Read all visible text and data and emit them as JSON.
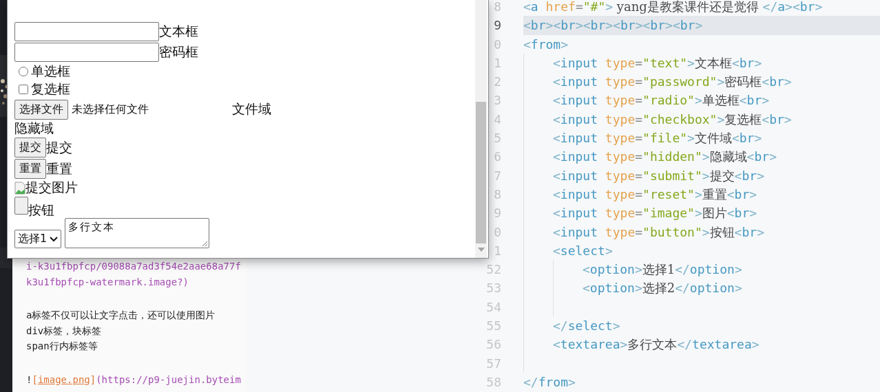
{
  "markdown_pane": {
    "blocks": [
      [
        {
          "tokens": [
            {
              "kind": "url",
              "text": "i-k3u1fbpfcp/09088a7ad3f54e2aae68a77f"
            }
          ]
        },
        {
          "tokens": [
            {
              "kind": "url",
              "text": "k3u1fbpfcp-watermark.image?)"
            }
          ]
        }
      ],
      [
        {
          "tokens": [
            {
              "kind": "text",
              "text": "a标签不仅可以让文字点击，还可以使用图片"
            }
          ]
        },
        {
          "tokens": [
            {
              "kind": "text",
              "text": "div标签，块标签"
            }
          ]
        },
        {
          "tokens": [
            {
              "kind": "text",
              "text": "span行内标签等"
            }
          ]
        }
      ],
      [
        {
          "tokens": [
            {
              "kind": "text",
              "text": "!"
            },
            {
              "kind": "linkmark",
              "text": "["
            },
            {
              "kind": "link",
              "text": "image.png"
            },
            {
              "kind": "linkmark",
              "text": "]"
            },
            {
              "kind": "url",
              "text": "(https://p9-juejin.byteim"
            }
          ]
        }
      ]
    ]
  },
  "editor": {
    "lines": [
      {
        "num": "8",
        "highlighted": false,
        "tokens": [
          {
            "kind": "punct",
            "text": "<"
          },
          {
            "kind": "tag",
            "text": "a"
          },
          {
            "kind": "attr",
            "text": " href"
          },
          {
            "kind": "eq",
            "text": "="
          },
          {
            "kind": "str",
            "text": "\"#\""
          },
          {
            "kind": "punct",
            "text": ">"
          },
          {
            "kind": "text",
            "text": " yang是教案课件还是觉得 "
          },
          {
            "kind": "punct",
            "text": "</"
          },
          {
            "kind": "tag",
            "text": "a"
          },
          {
            "kind": "punct",
            "text": ">"
          },
          {
            "kind": "punct",
            "text": "<"
          },
          {
            "kind": "tag",
            "text": "br"
          },
          {
            "kind": "punct",
            "text": ">"
          }
        ]
      },
      {
        "num": "9",
        "highlighted": true,
        "tokens": [
          {
            "kind": "punct",
            "text": "<"
          },
          {
            "kind": "tag",
            "text": "br"
          },
          {
            "kind": "punct",
            "text": ">"
          },
          {
            "kind": "punct",
            "text": "<"
          },
          {
            "kind": "tag",
            "text": "br"
          },
          {
            "kind": "punct",
            "text": ">"
          },
          {
            "kind": "punct",
            "text": "<"
          },
          {
            "kind": "tag",
            "text": "br"
          },
          {
            "kind": "punct",
            "text": ">"
          },
          {
            "kind": "punct",
            "text": "<"
          },
          {
            "kind": "tag",
            "text": "br"
          },
          {
            "kind": "punct",
            "text": ">"
          },
          {
            "kind": "punct",
            "text": "<"
          },
          {
            "kind": "tag",
            "text": "br"
          },
          {
            "kind": "punct",
            "text": ">"
          },
          {
            "kind": "punct",
            "text": "<"
          },
          {
            "kind": "tag",
            "text": "br"
          },
          {
            "kind": "punct",
            "text": ">"
          }
        ]
      },
      {
        "num": "0",
        "highlighted": false,
        "tokens": [
          {
            "kind": "punct",
            "text": "<"
          },
          {
            "kind": "tag",
            "text": "from"
          },
          {
            "kind": "punct",
            "text": ">"
          }
        ],
        "children": [
          {
            "num": "1",
            "highlighted": false,
            "tokens": [
              {
                "kind": "punct",
                "text": "<"
              },
              {
                "kind": "tag",
                "text": "input"
              },
              {
                "kind": "attr",
                "text": " type"
              },
              {
                "kind": "eq",
                "text": "="
              },
              {
                "kind": "str",
                "text": "\"text\""
              },
              {
                "kind": "punct",
                "text": ">"
              },
              {
                "kind": "text",
                "text": "文本框"
              },
              {
                "kind": "punct",
                "text": "<"
              },
              {
                "kind": "tag",
                "text": "br"
              },
              {
                "kind": "punct",
                "text": ">"
              }
            ]
          },
          {
            "num": "2",
            "highlighted": false,
            "tokens": [
              {
                "kind": "punct",
                "text": "<"
              },
              {
                "kind": "tag",
                "text": "input"
              },
              {
                "kind": "attr",
                "text": " type"
              },
              {
                "kind": "eq",
                "text": "="
              },
              {
                "kind": "str",
                "text": "\"password\""
              },
              {
                "kind": "punct",
                "text": ">"
              },
              {
                "kind": "text",
                "text": "密码框"
              },
              {
                "kind": "punct",
                "text": "<"
              },
              {
                "kind": "tag",
                "text": "br"
              },
              {
                "kind": "punct",
                "text": ">"
              }
            ]
          },
          {
            "num": "3",
            "highlighted": false,
            "tokens": [
              {
                "kind": "punct",
                "text": "<"
              },
              {
                "kind": "tag",
                "text": "input"
              },
              {
                "kind": "attr",
                "text": " type"
              },
              {
                "kind": "eq",
                "text": "="
              },
              {
                "kind": "str",
                "text": "\"radio\""
              },
              {
                "kind": "punct",
                "text": ">"
              },
              {
                "kind": "text",
                "text": "单选框"
              },
              {
                "kind": "punct",
                "text": "<"
              },
              {
                "kind": "tag",
                "text": "br"
              },
              {
                "kind": "punct",
                "text": ">"
              }
            ]
          },
          {
            "num": "4",
            "highlighted": false,
            "tokens": [
              {
                "kind": "punct",
                "text": "<"
              },
              {
                "kind": "tag",
                "text": "input"
              },
              {
                "kind": "attr",
                "text": " type"
              },
              {
                "kind": "eq",
                "text": "="
              },
              {
                "kind": "str",
                "text": "\"checkbox\""
              },
              {
                "kind": "punct",
                "text": ">"
              },
              {
                "kind": "text",
                "text": "复选框"
              },
              {
                "kind": "punct",
                "text": "<"
              },
              {
                "kind": "tag",
                "text": "br"
              },
              {
                "kind": "punct",
                "text": ">"
              }
            ]
          },
          {
            "num": "5",
            "highlighted": false,
            "tokens": [
              {
                "kind": "punct",
                "text": "<"
              },
              {
                "kind": "tag",
                "text": "input"
              },
              {
                "kind": "attr",
                "text": " type"
              },
              {
                "kind": "eq",
                "text": "="
              },
              {
                "kind": "str",
                "text": "\"file\""
              },
              {
                "kind": "punct",
                "text": ">"
              },
              {
                "kind": "text",
                "text": "文件域"
              },
              {
                "kind": "punct",
                "text": "<"
              },
              {
                "kind": "tag",
                "text": "br"
              },
              {
                "kind": "punct",
                "text": ">"
              }
            ]
          },
          {
            "num": "6",
            "highlighted": false,
            "tokens": [
              {
                "kind": "punct",
                "text": "<"
              },
              {
                "kind": "tag",
                "text": "input"
              },
              {
                "kind": "attr",
                "text": " type"
              },
              {
                "kind": "eq",
                "text": "="
              },
              {
                "kind": "str",
                "text": "\"hidden\""
              },
              {
                "kind": "punct",
                "text": ">"
              },
              {
                "kind": "text",
                "text": "隐藏域"
              },
              {
                "kind": "punct",
                "text": "<"
              },
              {
                "kind": "tag",
                "text": "br"
              },
              {
                "kind": "punct",
                "text": ">"
              }
            ]
          },
          {
            "num": "7",
            "highlighted": false,
            "tokens": [
              {
                "kind": "punct",
                "text": "<"
              },
              {
                "kind": "tag",
                "text": "input"
              },
              {
                "kind": "attr",
                "text": " type"
              },
              {
                "kind": "eq",
                "text": "="
              },
              {
                "kind": "str",
                "text": "\"submit\""
              },
              {
                "kind": "punct",
                "text": ">"
              },
              {
                "kind": "text",
                "text": "提交"
              },
              {
                "kind": "punct",
                "text": "<"
              },
              {
                "kind": "tag",
                "text": "br"
              },
              {
                "kind": "punct",
                "text": ">"
              }
            ]
          },
          {
            "num": "8",
            "highlighted": false,
            "tokens": [
              {
                "kind": "punct",
                "text": "<"
              },
              {
                "kind": "tag",
                "text": "input"
              },
              {
                "kind": "attr",
                "text": " type"
              },
              {
                "kind": "eq",
                "text": "="
              },
              {
                "kind": "str",
                "text": "\"reset\""
              },
              {
                "kind": "punct",
                "text": ">"
              },
              {
                "kind": "text",
                "text": "重置"
              },
              {
                "kind": "punct",
                "text": "<"
              },
              {
                "kind": "tag",
                "text": "br"
              },
              {
                "kind": "punct",
                "text": ">"
              }
            ]
          },
          {
            "num": "9",
            "highlighted": false,
            "tokens": [
              {
                "kind": "punct",
                "text": "<"
              },
              {
                "kind": "tag",
                "text": "input"
              },
              {
                "kind": "attr",
                "text": " type"
              },
              {
                "kind": "eq",
                "text": "="
              },
              {
                "kind": "str",
                "text": "\"image\""
              },
              {
                "kind": "punct",
                "text": ">"
              },
              {
                "kind": "text",
                "text": "图片"
              },
              {
                "kind": "punct",
                "text": "<"
              },
              {
                "kind": "tag",
                "text": "br"
              },
              {
                "kind": "punct",
                "text": ">"
              }
            ]
          },
          {
            "num": "0",
            "highlighted": false,
            "tokens": [
              {
                "kind": "punct",
                "text": "<"
              },
              {
                "kind": "tag",
                "text": "input"
              },
              {
                "kind": "attr",
                "text": " type"
              },
              {
                "kind": "eq",
                "text": "="
              },
              {
                "kind": "str",
                "text": "\"button\""
              },
              {
                "kind": "punct",
                "text": ">"
              },
              {
                "kind": "text",
                "text": "按钮"
              },
              {
                "kind": "punct",
                "text": "<"
              },
              {
                "kind": "tag",
                "text": "br"
              },
              {
                "kind": "punct",
                "text": ">"
              }
            ]
          },
          {
            "num": "1",
            "highlighted": false,
            "tokens": [
              {
                "kind": "punct",
                "text": "<"
              },
              {
                "kind": "tag",
                "text": "select"
              },
              {
                "kind": "punct",
                "text": ">"
              }
            ],
            "children": [
              {
                "num": "52",
                "highlighted": false,
                "tokens": [
                  {
                    "kind": "punct",
                    "text": "<"
                  },
                  {
                    "kind": "tag",
                    "text": "option"
                  },
                  {
                    "kind": "punct",
                    "text": ">"
                  },
                  {
                    "kind": "text",
                    "text": "选择1"
                  },
                  {
                    "kind": "punct",
                    "text": "</"
                  },
                  {
                    "kind": "tag",
                    "text": "option"
                  },
                  {
                    "kind": "punct",
                    "text": ">"
                  }
                ]
              },
              {
                "num": "53",
                "highlighted": false,
                "tokens": [
                  {
                    "kind": "punct",
                    "text": "<"
                  },
                  {
                    "kind": "tag",
                    "text": "option"
                  },
                  {
                    "kind": "punct",
                    "text": ">"
                  },
                  {
                    "kind": "text",
                    "text": "选择2"
                  },
                  {
                    "kind": "punct",
                    "text": "</"
                  },
                  {
                    "kind": "tag",
                    "text": "option"
                  },
                  {
                    "kind": "punct",
                    "text": ">"
                  }
                ]
              },
              {
                "num": "54",
                "highlighted": false
              }
            ]
          },
          {
            "num": "55",
            "highlighted": false,
            "tokens": [
              {
                "kind": "punct",
                "text": "</"
              },
              {
                "kind": "tag",
                "text": "select"
              },
              {
                "kind": "punct",
                "text": ">"
              }
            ]
          },
          {
            "num": "56",
            "highlighted": false,
            "tokens": [
              {
                "kind": "punct",
                "text": "<"
              },
              {
                "kind": "tag",
                "text": "textarea"
              },
              {
                "kind": "punct",
                "text": ">"
              },
              {
                "kind": "text",
                "text": "多行文本"
              },
              {
                "kind": "punct",
                "text": "</"
              },
              {
                "kind": "tag",
                "text": "textarea"
              },
              {
                "kind": "punct",
                "text": ">"
              }
            ]
          },
          {
            "num": "57",
            "highlighted": false
          }
        ]
      },
      {
        "num": "58",
        "highlighted": false,
        "tokens": [
          {
            "kind": "punct",
            "text": "</"
          },
          {
            "kind": "tag",
            "text": "from"
          },
          {
            "kind": "punct",
            "text": ">"
          }
        ]
      }
    ]
  },
  "browser_window": {
    "rows": [
      {
        "kind": "text-input",
        "label": "文本框"
      },
      {
        "kind": "password-input",
        "label": "密码框"
      },
      {
        "kind": "radio",
        "checked": false,
        "label": "单选框"
      },
      {
        "kind": "checkbox",
        "checked": false,
        "label": "复选框"
      },
      {
        "kind": "file",
        "button": "选择文件",
        "status": "未选择任何文件",
        "label": "文件域"
      },
      {
        "kind": "text",
        "label": "隐藏域"
      },
      {
        "kind": "button",
        "button": "提交",
        "label": "提交"
      },
      {
        "kind": "button",
        "button": "重置",
        "label": "重置"
      },
      {
        "kind": "image-input",
        "alt": "提交",
        "label": "图片"
      },
      {
        "kind": "empty-button",
        "label": "按钮"
      },
      {
        "kind": "select-textarea",
        "select": "选择1",
        "textarea": "多行文本"
      }
    ]
  }
}
